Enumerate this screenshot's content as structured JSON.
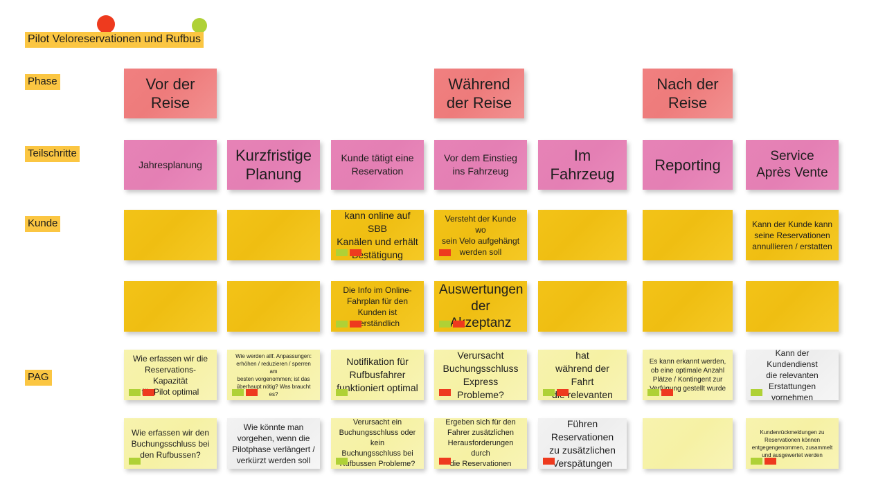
{
  "board": {
    "title": "Pilot Veloreservationen und Rufbus",
    "row_labels": {
      "phase": "Phase",
      "teilschritte": "Teilschritte",
      "kunde": "Kunde",
      "pag": "PAG"
    },
    "legend_dots": [
      {
        "name": "red-dot",
        "color": "#EE3A1E"
      },
      {
        "name": "green-dot",
        "color": "#AFD136"
      }
    ],
    "colors": {
      "highlight": "#FBC642",
      "phase_note": "#F08080",
      "step_note": "#E683B6",
      "yellow_note": "#F3C318",
      "pale_yellow_note": "#F7F3AE",
      "white_note": "#F2F2F2",
      "chip_green": "#AFD136",
      "chip_red": "#EE3A1E"
    }
  },
  "phases": [
    {
      "label": "Vor der\nReise"
    },
    {
      "label": "Während\nder Reise"
    },
    {
      "label": "Nach der\nReise"
    }
  ],
  "steps": [
    {
      "label": "Jahresplanung"
    },
    {
      "label": "Kurzfristige\nPlanung"
    },
    {
      "label": "Kunde tätigt eine\nReservation"
    },
    {
      "label": "Vor dem Einstieg\nins Fahrzeug"
    },
    {
      "label": "Im\nFahrzeug"
    },
    {
      "label": "Reporting"
    },
    {
      "label": "Service\nAprès Vente"
    }
  ],
  "rows": [
    {
      "name": "kunde-row-1",
      "notes": [
        {
          "text": "",
          "chips": []
        },
        {
          "text": "",
          "chips": []
        },
        {
          "text": "kann online auf SBB\nKanälen und erhält\nBestätigung",
          "chips": [
            "green",
            "red"
          ]
        },
        {
          "text": "Versteht der Kunde wo\nsein Velo aufgehängt\nwerden soll",
          "chips": [
            "red"
          ]
        },
        {
          "text": "",
          "chips": []
        },
        {
          "text": "",
          "chips": []
        },
        {
          "text": "Kann der Kunde kann\nseine Reservationen\nannullieren / erstatten",
          "chips": []
        }
      ]
    },
    {
      "name": "kunde-row-2",
      "notes": [
        {
          "text": "",
          "chips": []
        },
        {
          "text": "",
          "chips": []
        },
        {
          "text": "Die Info im Online-\nFahrplan für den\nKunden ist verständlich",
          "chips": [
            "green",
            "red"
          ]
        },
        {
          "text": "Auswertungen\nder Akzeptanz",
          "chips": [
            "green",
            "red"
          ]
        },
        {
          "text": "",
          "chips": []
        },
        {
          "text": "",
          "chips": []
        },
        {
          "text": "",
          "chips": []
        }
      ]
    },
    {
      "name": "pag-row-1",
      "notes": [
        {
          "text": "Wie erfassen wir die\nReservations-Kapazität\nfür Pilot optimal",
          "chips": [
            "green",
            "red"
          ]
        },
        {
          "text": "Wie werden allf. Anpassungen:\nerhöhen / reduzieren / sperren am\nbesten vorgenommen; ist das\nüberhaupt nötig? Was braucht es?",
          "chips": [
            "green",
            "red"
          ]
        },
        {
          "text": "Notifikation für\nRufbusfahrer\nfunktioniert optimal",
          "chips": [
            "green"
          ]
        },
        {
          "text": "Verursacht\nBuchungsschluss\nExpress Probleme?",
          "chips": [
            "red"
          ]
        },
        {
          "text": "Hat der Fahrer hat\nwährend der Fahrt\ndie relevanten Infos",
          "chips": [
            "green",
            "red"
          ]
        },
        {
          "text": "Es kann erkannt werden,\nob eine optimale Anzahl\nPlätze / Kontingent zur\nVerfügung gestellt wurde",
          "chips": [
            "green",
            "red"
          ]
        },
        {
          "text": "Kann der Kundendienst\ndie relevanten\nErstattungen vornehmen",
          "chips": [
            "green"
          ]
        }
      ]
    },
    {
      "name": "pag-row-2",
      "notes": [
        {
          "text": "Wie erfassen wir den\nBuchungsschluss bei\nden Rufbussen?",
          "chips": [
            "green"
          ]
        },
        {
          "text": "Wie könnte man\nvorgehen, wenn die\nPilotphase verlängert /\nverkürzt werden soll",
          "chips": []
        },
        {
          "text": "Verursacht ein\nBuchungsschluss oder kein\nBuchungsschluss bei\nRufbussen Probleme?",
          "chips": [
            "green"
          ]
        },
        {
          "text": "Ergeben sich für den\nFahrer zusätzlichen\nHerausforderungen durch\ndie Reservationen",
          "chips": [
            "red"
          ]
        },
        {
          "text": "Führen Reservationen\nzu zusätzlichen\nVerspätungen",
          "chips": [
            "red"
          ]
        },
        {
          "text": "",
          "chips": []
        },
        {
          "text": "Kundenrückmeldungen zu\nReservationen können\nentgegengenommen, zusammelt\nund ausgewertet werden",
          "chips": [
            "green",
            "red"
          ]
        }
      ]
    }
  ]
}
